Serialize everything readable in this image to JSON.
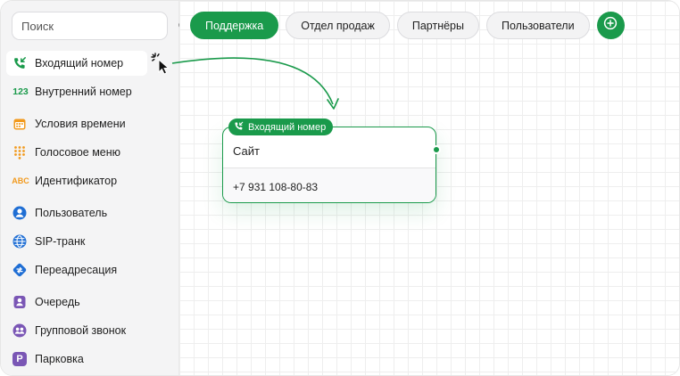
{
  "colors": {
    "accent": "#1a9a4b",
    "orange": "#f29a1e",
    "blue": "#1f6ed4",
    "purple": "#7a56b5"
  },
  "search": {
    "placeholder": "Поиск",
    "icon": "search-icon"
  },
  "sidebar": {
    "items": [
      {
        "label": "Входящий номер",
        "icon": "incoming-call-icon"
      },
      {
        "label": "Внутренний номер",
        "icon": "number-123-icon",
        "icon_text": "123"
      },
      {
        "label": "Условия времени",
        "icon": "calendar-icon"
      },
      {
        "label": "Голосовое меню",
        "icon": "keypad-icon"
      },
      {
        "label": "Идентификатор",
        "icon": "abc-icon",
        "icon_text": "ABC"
      },
      {
        "label": "Пользователь",
        "icon": "user-icon"
      },
      {
        "label": "SIP-транк",
        "icon": "globe-icon"
      },
      {
        "label": "Переадресация",
        "icon": "redirect-icon"
      },
      {
        "label": "Очередь",
        "icon": "queue-icon"
      },
      {
        "label": "Групповой звонок",
        "icon": "group-icon"
      },
      {
        "label": "Парковка",
        "icon": "parking-icon",
        "icon_text": "P"
      }
    ]
  },
  "tabs": [
    {
      "label": "Поддержка",
      "active": true
    },
    {
      "label": "Отдел продаж",
      "active": false
    },
    {
      "label": "Партнёры",
      "active": false
    },
    {
      "label": "Пользователи",
      "active": false
    }
  ],
  "node": {
    "badge": "Входящий номер",
    "title": "Сайт",
    "phone": "+7 931 108-80-83"
  }
}
